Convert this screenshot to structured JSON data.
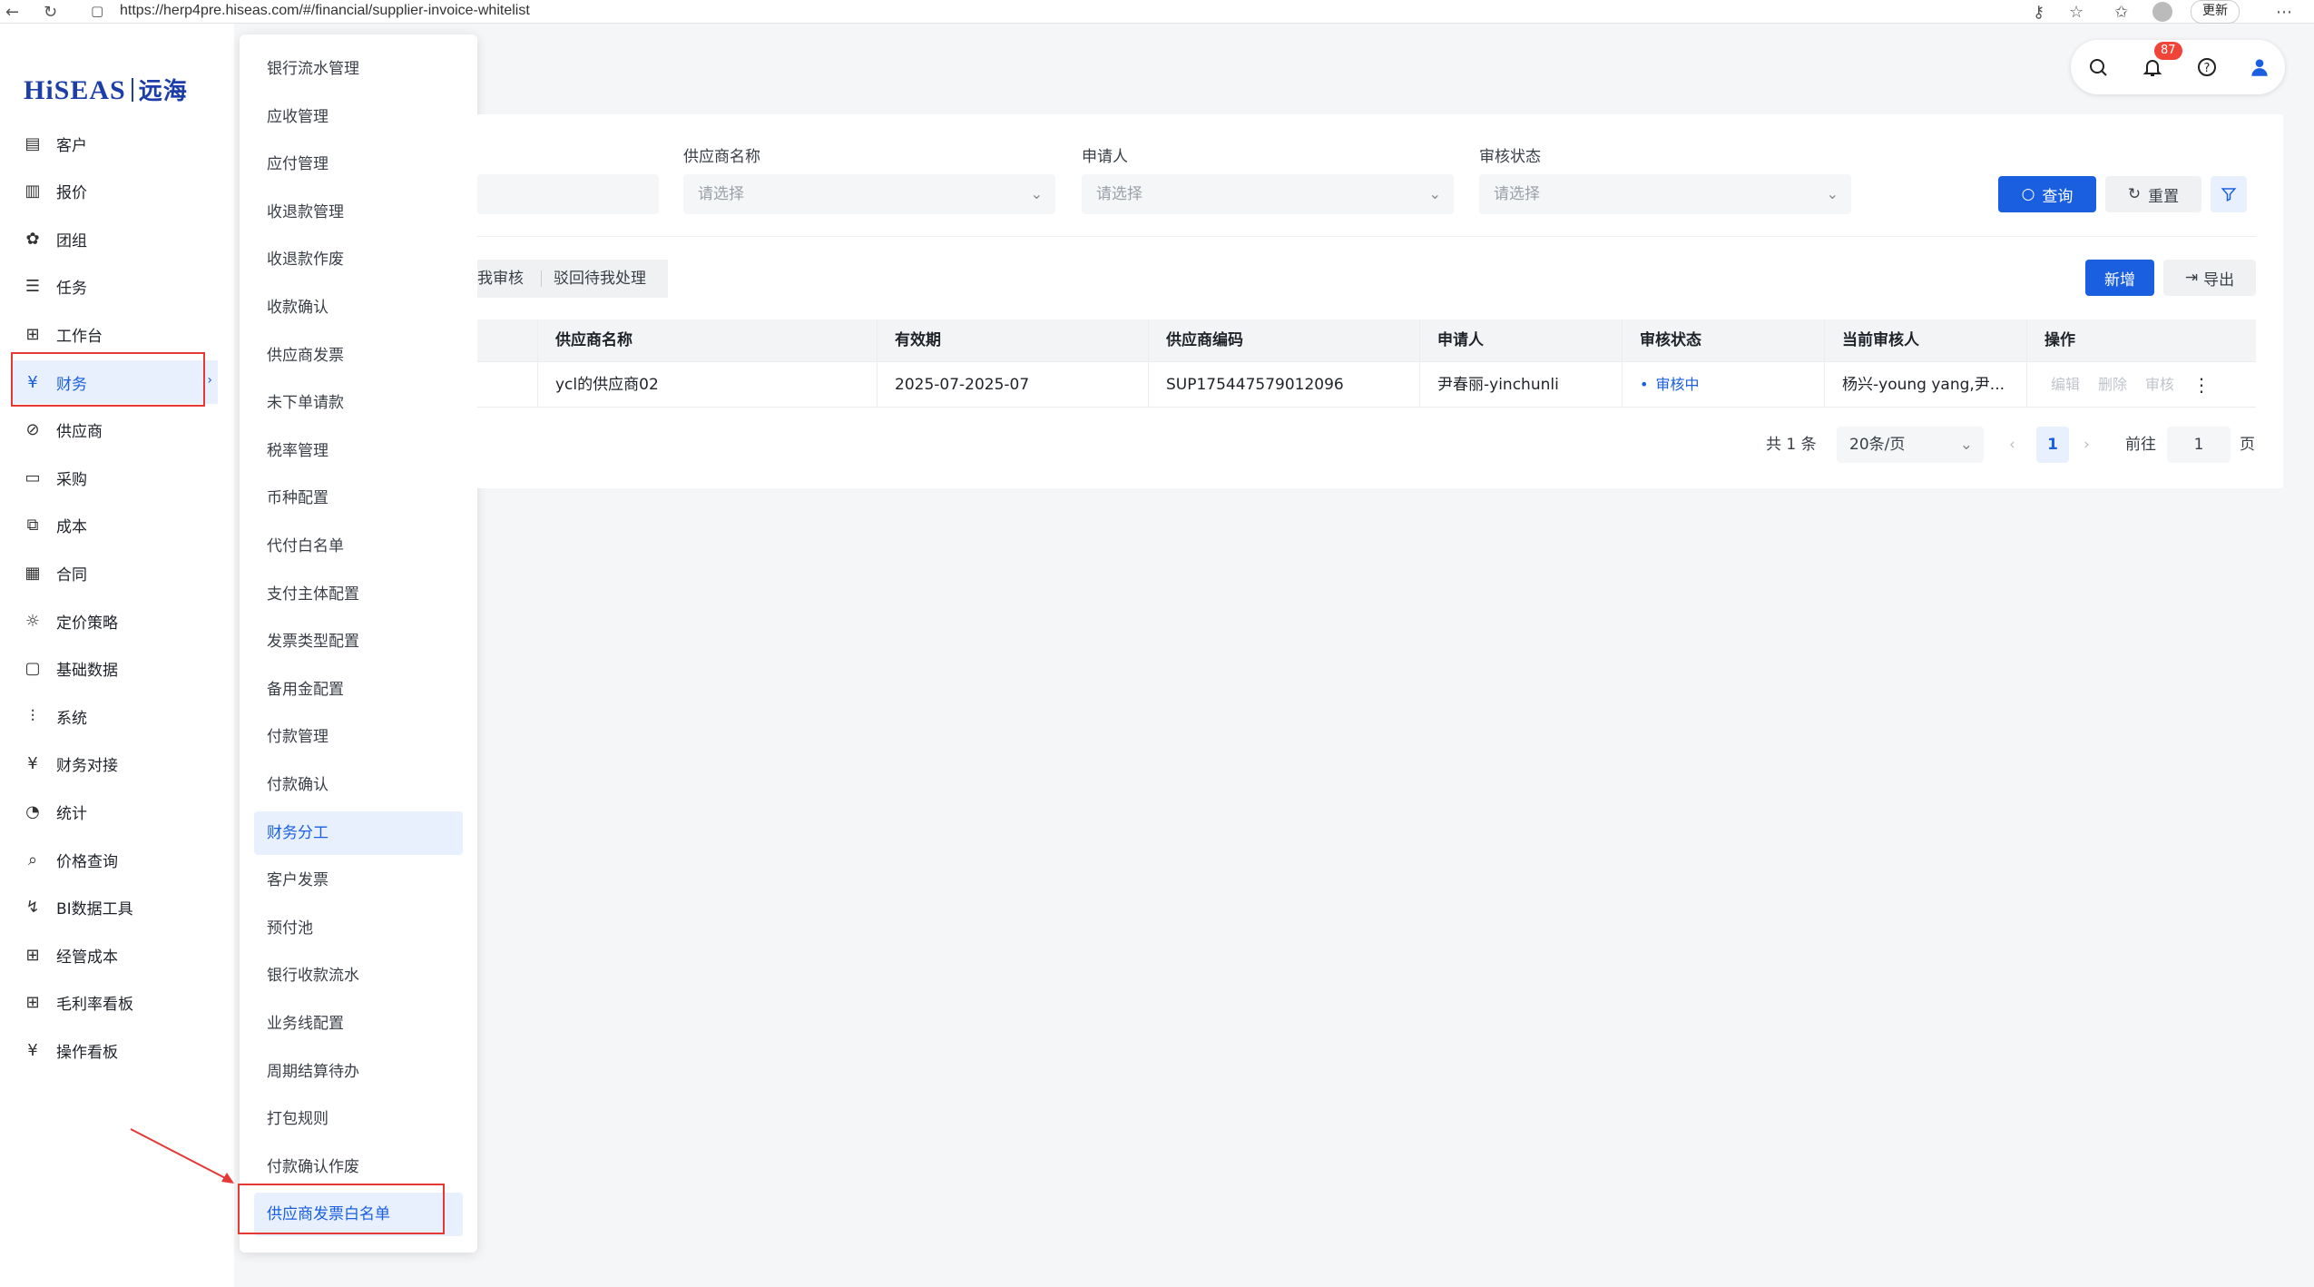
{
  "browser": {
    "url": "https://herp4pre.hiseas.com/#/financial/supplier-invoice-whitelist",
    "update_label": "更新"
  },
  "logo": {
    "brand": "HiSEAS",
    "brand_cn": "远海"
  },
  "sidebar": {
    "items": [
      {
        "label": "客户",
        "icon": "customer-icon"
      },
      {
        "label": "报价",
        "icon": "quote-icon"
      },
      {
        "label": "团组",
        "icon": "group-icon"
      },
      {
        "label": "任务",
        "icon": "task-icon"
      },
      {
        "label": "工作台",
        "icon": "workbench-icon"
      },
      {
        "label": "财务",
        "icon": "finance-icon",
        "active": true
      },
      {
        "label": "供应商",
        "icon": "supplier-icon"
      },
      {
        "label": "采购",
        "icon": "purchase-icon"
      },
      {
        "label": "成本",
        "icon": "cost-icon"
      },
      {
        "label": "合同",
        "icon": "contract-icon"
      },
      {
        "label": "定价策略",
        "icon": "pricing-icon"
      },
      {
        "label": "基础数据",
        "icon": "folder-icon"
      },
      {
        "label": "系统",
        "icon": "system-icon"
      },
      {
        "label": "财务对接",
        "icon": "finance-link-icon"
      },
      {
        "label": "统计",
        "icon": "stats-icon"
      },
      {
        "label": "价格查询",
        "icon": "price-search-icon"
      },
      {
        "label": "BI数据工具",
        "icon": "bi-icon"
      },
      {
        "label": "经管成本",
        "icon": "mgmt-cost-icon"
      },
      {
        "label": "毛利率看板",
        "icon": "margin-board-icon"
      },
      {
        "label": "操作看板",
        "icon": "ops-board-icon"
      }
    ]
  },
  "submenu": {
    "items": [
      "银行流水管理",
      "应收管理",
      "应付管理",
      "收退款管理",
      "收退款作废",
      "收款确认",
      "供应商发票",
      "未下单请款",
      "税率管理",
      "币种配置",
      "代付白名单",
      "支付主体配置",
      "发票类型配置",
      "备用金配置",
      "付款管理",
      "付款确认",
      "财务分工",
      "客户发票",
      "预付池",
      "银行收款流水",
      "业务线配置",
      "周期结算待办",
      "打包规则",
      "付款确认作废",
      "供应商发票白名单"
    ],
    "active_index": 16,
    "selected_index": 24
  },
  "header": {
    "notification_count": "87"
  },
  "filters": {
    "supplier_label": "供应商名称",
    "applicant_label": "申请人",
    "status_label": "审核状态",
    "placeholder": "请选择",
    "search_button": "查询",
    "reset_button": "重置"
  },
  "tabs": {
    "review_by_me": "我审核",
    "rejected_pending": "驳回待我处理"
  },
  "toolbar": {
    "add_button": "新增",
    "export_button": "导出"
  },
  "table": {
    "headers": [
      "供应商名称",
      "有效期",
      "供应商编码",
      "申请人",
      "审核状态",
      "当前审核人",
      "操作"
    ],
    "rows": [
      {
        "supplier": "ycl的供应商02",
        "validity": "2025-07-2025-07",
        "code": "SUP175447579012096",
        "applicant": "尹春丽-yinchunli",
        "status": "审核中",
        "reviewer": "杨兴-young yang,尹...",
        "actions": [
          "编辑",
          "删除",
          "审核"
        ]
      }
    ]
  },
  "pagination": {
    "total": "共 1 条",
    "page_size": "20条/页",
    "current_page": "1",
    "goto_label": "前往",
    "goto_value": "1",
    "page_suffix": "页"
  },
  "colors": {
    "accent": "#1a5fe0",
    "annotation": "#e53935",
    "badge": "#f04438"
  }
}
